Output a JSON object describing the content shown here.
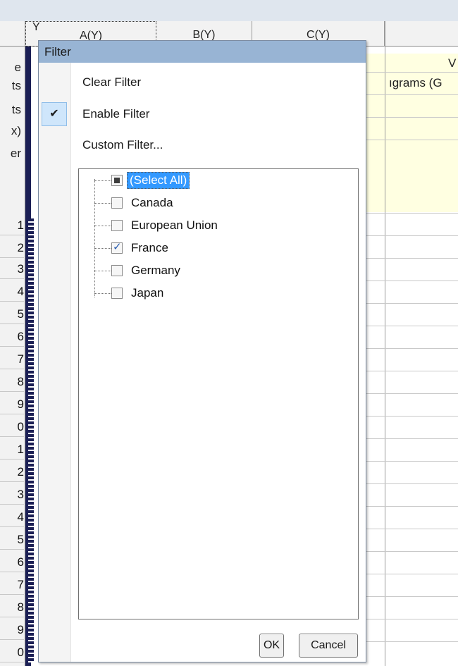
{
  "spreadsheet": {
    "columns": [
      "A(Y)",
      "B(Y)",
      "C(Y)"
    ],
    "row_labels": [
      "e",
      "ts",
      "ts",
      "x)",
      "er"
    ],
    "row_numbers": [
      "1",
      "2",
      "3",
      "4",
      "5",
      "6",
      "7",
      "8",
      "9",
      "0",
      "1",
      "2",
      "3",
      "4",
      "5",
      "6",
      "7",
      "8",
      "9",
      "0"
    ],
    "long_name_fragment": "V",
    "units_fragment": "ıgrams (G"
  },
  "filter_popup": {
    "title": "Filter",
    "menu": {
      "clear": "Clear Filter",
      "enable": "Enable Filter",
      "custom": "Custom Filter..."
    },
    "enable_checked_glyph": "✔",
    "list": [
      {
        "label": "(Select All)",
        "state": "indeterminate",
        "selected": true
      },
      {
        "label": "Canada",
        "state": "unchecked",
        "selected": false
      },
      {
        "label": "European Union",
        "state": "unchecked",
        "selected": false
      },
      {
        "label": "France",
        "state": "checked",
        "selected": false
      },
      {
        "label": "Germany",
        "state": "unchecked",
        "selected": false
      },
      {
        "label": "Japan",
        "state": "unchecked",
        "selected": false
      }
    ],
    "ok_label": "OK",
    "cancel_label": "Cancel"
  },
  "icons": {
    "filter_glyph": "Y",
    "check_glyph": "✓"
  },
  "colors": {
    "title_bar": "#98b4d4",
    "selection": "#3399ff",
    "metadata_bg": "#ffffe1",
    "selected_column": "#1b1f55"
  }
}
